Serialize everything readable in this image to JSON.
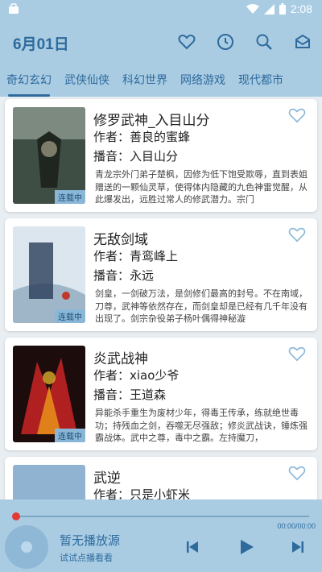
{
  "status_bar": {
    "time": "2:08"
  },
  "header": {
    "date": "6月01日"
  },
  "tabs": [
    "奇幻玄幻",
    "武侠仙侠",
    "科幻世界",
    "网络游戏",
    "现代都市"
  ],
  "books": [
    {
      "title": "修罗武神_入目山分",
      "author": "作者：善良的蜜蜂",
      "narrator": "播音：入目山分",
      "badge": "连载中",
      "desc": "青龙宗外门弟子楚枫，因修为低下饱受欺辱，直到表姐赠送的一颗仙灵草，使得体内隐藏的九色神雷觉醒，从此爆发出，远胜过常人的修武潜力。宗门",
      "cover_color": "#4a5a4a"
    },
    {
      "title": "无敌剑域",
      "author": "作者：青鸾峰上",
      "narrator": "播音：永远",
      "badge": "连载中",
      "desc": "剑皇，一剑破万法，是剑修们最高的封号。不在南域，刀尊，武神等依然存在，而剑皇却是已经有几千年没有出现了。剑宗杂役弟子杨叶偶得神秘漩",
      "cover_color": "#c9d8e6"
    },
    {
      "title": "炎武战神",
      "author": "作者：xiao少爷",
      "narrator": "播音：王道森",
      "badge": "连载中",
      "desc": "异能杀手重生为废材少年，得毒王传承，练就绝世毒功；持残血之剑，吞噬无尽强敌；修炎武战诀，锤炼强霸战体。武中之尊，毒中之霸。左持魔刀，",
      "cover_color": "#3a1414"
    },
    {
      "title": "武逆",
      "author": "作者：只是小虾米",
      "narrator": "",
      "badge": "",
      "desc": "",
      "cover_color": "#8fb3d1"
    }
  ],
  "player": {
    "title": "暂无播放源",
    "subtitle": "试试点播看看",
    "time": "00:00/00:00"
  },
  "colors": {
    "accent": "#2e6a9c",
    "header_bg": "#a9cce3",
    "progress_dot": "#e53935"
  }
}
